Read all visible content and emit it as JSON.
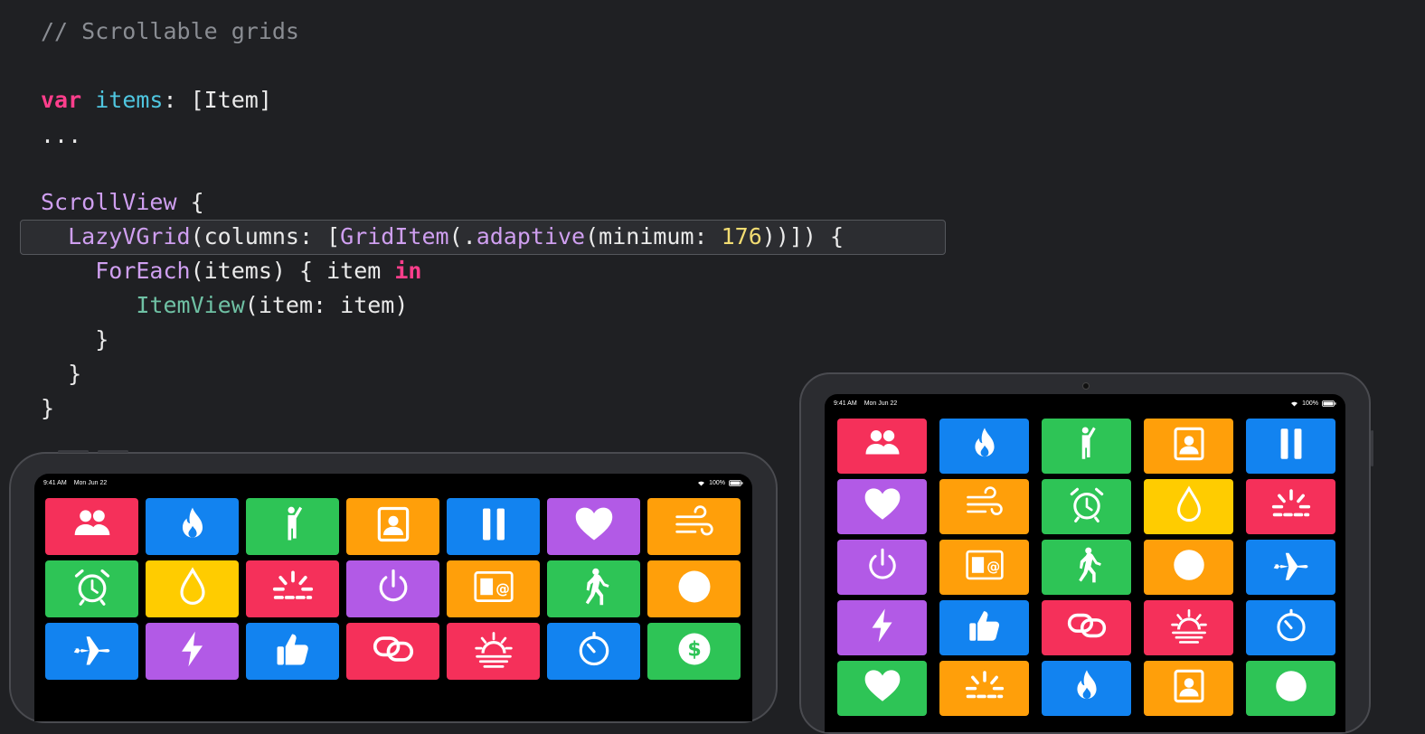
{
  "code": {
    "line1": "// Scrollable grids",
    "line2_kw": "var",
    "line2_var": "items",
    "line2_rest": ": [Item]",
    "line3": "...",
    "line5_type": "ScrollView",
    "line5_rest": " {",
    "line6_type": "LazyVGrid",
    "line6_a": "(columns: [",
    "line6_type2": "GridItem",
    "line6_b": "(.",
    "line6_member": "adaptive",
    "line6_c": "(minimum: ",
    "line6_num": "176",
    "line6_d": "))]) {",
    "line7_type": "ForEach",
    "line7_a": "(items) { item ",
    "line7_kw": "in",
    "line8_fn": "ItemView",
    "line8_a": "(item: item)",
    "line9": "}",
    "line10": "}",
    "line11": "}"
  },
  "ipad_left": {
    "time": "9:41 AM",
    "date": "Mon Jun 22",
    "battery": "100%",
    "tiles": [
      {
        "color": "#f5305a",
        "icon": "people-icon"
      },
      {
        "color": "#1283f0",
        "icon": "flame-icon"
      },
      {
        "color": "#2ec456",
        "icon": "figure-wave-icon"
      },
      {
        "color": "#ff9f0a",
        "icon": "contact-card-icon"
      },
      {
        "color": "#1283f0",
        "icon": "pause-icon"
      },
      {
        "color": "#b25ae6",
        "icon": "heart-icon"
      },
      {
        "color": "#ff9f0a",
        "icon": "wind-icon"
      },
      {
        "color": "#2ec456",
        "icon": "alarm-icon"
      },
      {
        "color": "#ffcc00",
        "icon": "drop-icon"
      },
      {
        "color": "#f5305a",
        "icon": "sunrise-rays-icon"
      },
      {
        "color": "#b25ae6",
        "icon": "power-icon"
      },
      {
        "color": "#ff9f0a",
        "icon": "person-at-card-icon"
      },
      {
        "color": "#2ec456",
        "icon": "figure-walk-icon"
      },
      {
        "color": "#ff9f0a",
        "icon": "circle-icon"
      },
      {
        "color": "#1283f0",
        "icon": "airplane-icon"
      },
      {
        "color": "#b25ae6",
        "icon": "bolt-icon"
      },
      {
        "color": "#1283f0",
        "icon": "thumbs-up-icon"
      },
      {
        "color": "#f5305a",
        "icon": "link-icon"
      },
      {
        "color": "#f5305a",
        "icon": "sunset-icon"
      },
      {
        "color": "#1283f0",
        "icon": "timer-icon"
      },
      {
        "color": "#2ec456",
        "icon": "dollar-circle-icon"
      }
    ]
  },
  "ipad_right": {
    "time": "9:41 AM",
    "date": "Mon Jun 22",
    "battery": "100%",
    "tiles": [
      {
        "color": "#f5305a",
        "icon": "people-icon"
      },
      {
        "color": "#1283f0",
        "icon": "flame-icon"
      },
      {
        "color": "#2ec456",
        "icon": "figure-wave-icon"
      },
      {
        "color": "#ff9f0a",
        "icon": "contact-card-icon"
      },
      {
        "color": "#1283f0",
        "icon": "pause-icon"
      },
      {
        "color": "#b25ae6",
        "icon": "heart-icon"
      },
      {
        "color": "#ff9f0a",
        "icon": "wind-icon"
      },
      {
        "color": "#2ec456",
        "icon": "alarm-icon"
      },
      {
        "color": "#ffcc00",
        "icon": "drop-icon"
      },
      {
        "color": "#f5305a",
        "icon": "sunrise-rays-icon"
      },
      {
        "color": "#b25ae6",
        "icon": "power-icon"
      },
      {
        "color": "#ff9f0a",
        "icon": "person-at-card-icon"
      },
      {
        "color": "#2ec456",
        "icon": "figure-walk-icon"
      },
      {
        "color": "#ff9f0a",
        "icon": "circle-icon"
      },
      {
        "color": "#1283f0",
        "icon": "airplane-icon"
      },
      {
        "color": "#b25ae6",
        "icon": "bolt-icon"
      },
      {
        "color": "#1283f0",
        "icon": "thumbs-up-icon"
      },
      {
        "color": "#f5305a",
        "icon": "link-icon"
      },
      {
        "color": "#f5305a",
        "icon": "sunset-icon"
      },
      {
        "color": "#1283f0",
        "icon": "timer-icon"
      },
      {
        "color": "#2ec456",
        "icon": "heart-icon"
      },
      {
        "color": "#ff9f0a",
        "icon": "sunrise-rays-icon"
      },
      {
        "color": "#1283f0",
        "icon": "flame-icon"
      },
      {
        "color": "#ff9f0a",
        "icon": "contact-card-icon"
      },
      {
        "color": "#2ec456",
        "icon": "circle-icon"
      }
    ]
  }
}
